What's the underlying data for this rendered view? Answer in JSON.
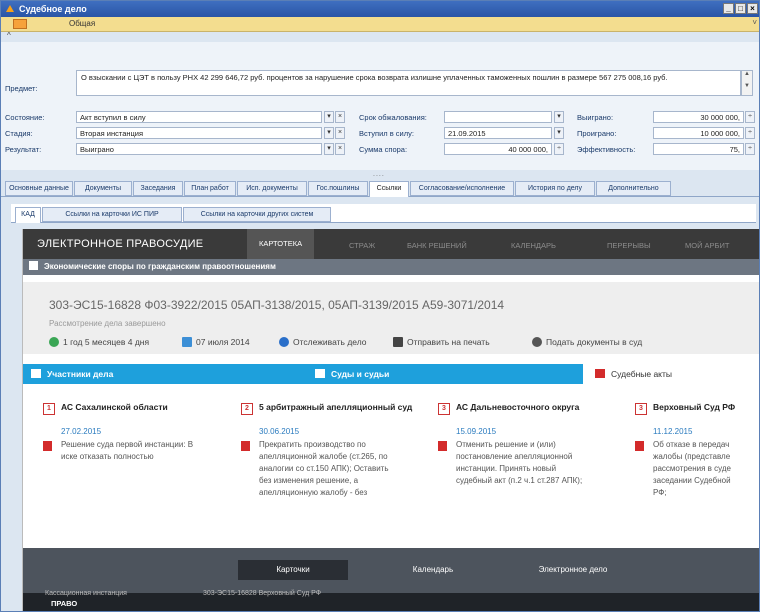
{
  "window": {
    "title": "Судебное дело"
  },
  "menu": {
    "tab_label": "Общая"
  },
  "form": {
    "subject_label": "Предмет:",
    "subject_value": "О взыскании с ЦЭТ в пользу РНХ 42 299 646,72 руб. процентов за нарушение срока возврата излишне уплаченных таможенных пошлин в размере 567 275 008,16 руб.",
    "state_label": "Состояние:",
    "state_value": "Акт вступил в силу",
    "stage_label": "Стадия:",
    "stage_value": "Вторая инстанция",
    "result_label": "Результат:",
    "result_value": "Выиграно",
    "appeal_label": "Срок обжалования:",
    "appeal_value": "",
    "effective_label": "Вступил в силу:",
    "effective_value": "21.09.2015",
    "sum_label": "Сумма спора:",
    "sum_value": "40 000 000,",
    "won_label": "Выиграно:",
    "won_value": "30 000 000,",
    "lost_label": "Проиграно:",
    "lost_value": "10 000 000,",
    "eff_label": "Эффективность:",
    "eff_value": "75,",
    "grip": "...."
  },
  "tabs": [
    "Основные данные",
    "Документы",
    "Заседания",
    "План работ",
    "Исп. документы",
    "Гос.пошлины",
    "Ссылки",
    "Согласование/исполнение",
    "История по делу",
    "Дополнительно"
  ],
  "subtabs": [
    "КАД",
    "Ссылки на карточки ИС ПИР",
    "Ссылки на карточки других систем"
  ],
  "kad": {
    "brand": "ЭЛЕКТРОННОЕ ПРАВОСУДИЕ",
    "nav": [
      "КАРТОТЕКА",
      "СТРАЖ",
      "БАНК РЕШЕНИЙ",
      "КАЛЕНДАРЬ",
      "ПЕРЕРЫВЫ",
      "МОЙ АРБИТ"
    ],
    "category": "Экономические споры по гражданским правоотношениям",
    "case_numbers": "303-ЭС15-16828   Ф03-3922/2015   05АП-3138/2015, 05АП-3139/2015   А59-3071/2014",
    "case_status": "Рассмотрение дела завершено",
    "actions": [
      "1 год 5 месяцев 4 дня",
      "07 июля 2014",
      "Отслеживать дело",
      "Отправить на печать",
      "Подать документы в суд"
    ],
    "sections": [
      "Участники дела",
      "Суды и судьи",
      "Судебные акты"
    ],
    "courts": [
      {
        "num": "1",
        "name": "АС Сахалинской области",
        "date": "27.02.2015",
        "text": [
          "Решение суда первой инстанции: В",
          "иске отказать полностью"
        ]
      },
      {
        "num": "2",
        "name": "5 арбитражный апелляционный суд",
        "date": "30.06.2015",
        "text": [
          "Прекратить производство по",
          "апелляционной жалобе (ст.265, по",
          "аналогии со ст.150 АПК); Оставить",
          "без изменения решение, а",
          "апелляционную жалобу - без"
        ]
      },
      {
        "num": "3",
        "name": "АС Дальневосточного округа",
        "date": "15.09.2015",
        "text": [
          "Отменить решение и (или)",
          "постановление апелляционной",
          "инстанции. Принять новый",
          "судебный акт (п.2 ч.1 ст.287 АПК);"
        ]
      },
      {
        "num": "3",
        "name": "Верховный Суд РФ",
        "date": "11.12.2015",
        "text": [
          "Об отказе в передач",
          "жалобы (представле",
          "рассмотрения в суде",
          "заседании Судебной",
          "РФ;"
        ]
      }
    ],
    "bottom_tabs": [
      "Карточки",
      "Календарь",
      "Электронное дело"
    ],
    "footer_logo": "ПРАВО",
    "footer_ghost": "303-ЭС15-16828 Верховный Суд РФ",
    "ghost_left": "Кассационная инстанция"
  },
  "colors": {
    "accent": "#1ea0dc",
    "pdf": "#d32b2b",
    "titlebar": "#2a55a6"
  }
}
